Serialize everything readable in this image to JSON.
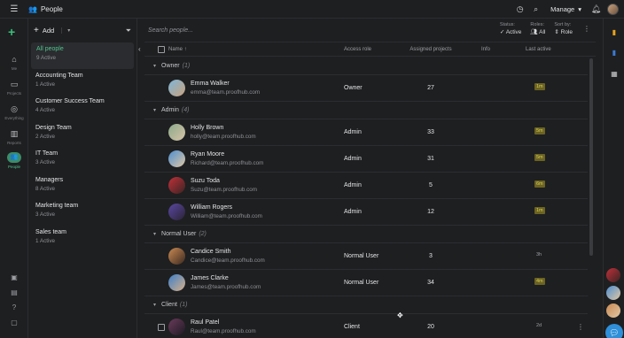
{
  "topbar": {
    "title": "People",
    "manage_label": "Manage",
    "icons": [
      "menu-icon",
      "people-icon",
      "clock-icon",
      "search-icon",
      "chevron-down-icon",
      "bell-icon",
      "avatar"
    ]
  },
  "leftnav": {
    "items": [
      {
        "label": "Me",
        "icon": "home-icon"
      },
      {
        "label": "Projects",
        "icon": "folder-icon"
      },
      {
        "label": "Everything",
        "icon": "globe-icon"
      },
      {
        "label": "Reports",
        "icon": "chart-icon"
      },
      {
        "label": "People",
        "icon": "people-icon"
      }
    ]
  },
  "groups": {
    "add_label": "Add",
    "items": [
      {
        "name": "All people",
        "count": "9 Active"
      },
      {
        "name": "Accounting Team",
        "count": "1 Active"
      },
      {
        "name": "Customer Success Team",
        "count": "4 Active"
      },
      {
        "name": "Design Team",
        "count": "2 Active"
      },
      {
        "name": "IT Team",
        "count": "3 Active"
      },
      {
        "name": "Managers",
        "count": "8 Active"
      },
      {
        "name": "Marketing team",
        "count": "3 Active"
      },
      {
        "name": "Sales team",
        "count": "1 Active"
      }
    ]
  },
  "main": {
    "search_placeholder": "Search people...",
    "status": {
      "label": "Status:",
      "value": "Active"
    },
    "roles": {
      "label": "Roles:",
      "value": "All"
    },
    "sortby": {
      "label": "Sort by:",
      "value": "Role"
    },
    "columns": {
      "name": "Name",
      "access": "Access role",
      "projects": "Assigned projects",
      "info": "Info",
      "last": "Last active"
    },
    "sections": [
      {
        "title": "Owner",
        "count": "(1)",
        "people": [
          {
            "name": "Emma Walker",
            "email": "emma@team.proofhub.com",
            "role": "Owner",
            "projects": "27",
            "last": "1m"
          }
        ]
      },
      {
        "title": "Admin",
        "count": "(4)",
        "people": [
          {
            "name": "Holly Brown",
            "email": "holly@team.proofhub.com",
            "role": "Admin",
            "projects": "33",
            "last": "5m"
          },
          {
            "name": "Ryan Moore",
            "email": "Richard@team.proofhub.com",
            "role": "Admin",
            "projects": "31",
            "last": "5m"
          },
          {
            "name": "Suzu Toda",
            "email": "Suzu@team.proofhub.com",
            "role": "Admin",
            "projects": "5",
            "last": "6m"
          },
          {
            "name": "William Rogers",
            "email": "William@team.proofhub.com",
            "role": "Admin",
            "projects": "12",
            "last": "1m"
          }
        ]
      },
      {
        "title": "Normal User",
        "count": "(2)",
        "people": [
          {
            "name": "Candice Smith",
            "email": "Candice@team.proofhub.com",
            "role": "Normal User",
            "projects": "3",
            "last": "3h"
          },
          {
            "name": "James Clarke",
            "email": "James@team.proofhub.com",
            "role": "Normal User",
            "projects": "34",
            "last": "4m"
          }
        ]
      },
      {
        "title": "Client",
        "count": "(1)",
        "people": [
          {
            "name": "Raul Patel",
            "email": "Raul@team.proofhub.com",
            "role": "Client",
            "projects": "20",
            "last": "2d"
          }
        ]
      }
    ]
  },
  "colors": {
    "accent": "#39c07a",
    "badge_bg": "#6b6322",
    "badge_text": "#d8cd58",
    "bg": "#1e1f21"
  }
}
